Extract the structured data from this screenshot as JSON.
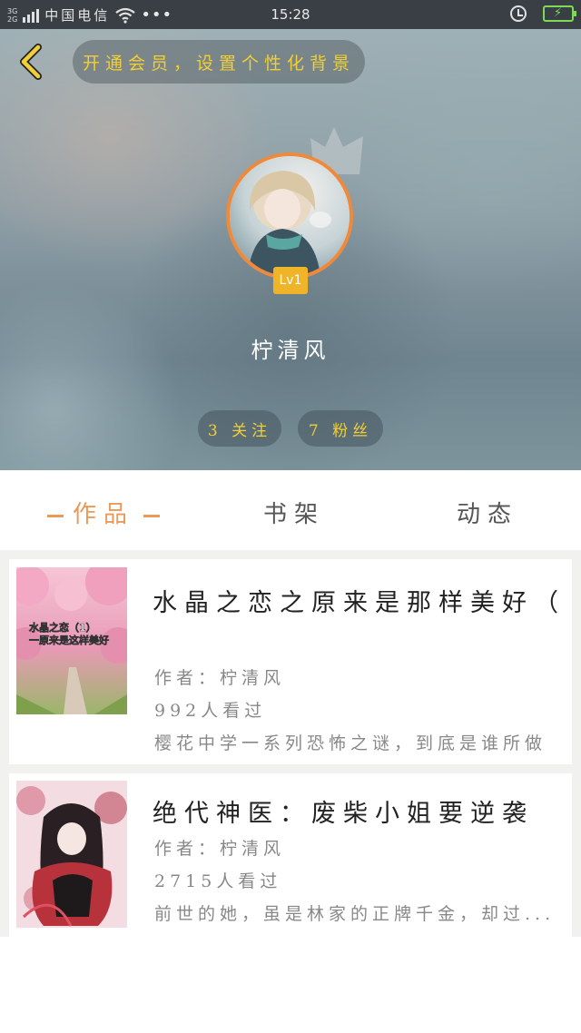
{
  "status_bar": {
    "network": "3G\n2G",
    "carrier": "中国电信",
    "more": "•••",
    "time": "15:28"
  },
  "header": {
    "vip_banner": "开通会员，设置个性化背景",
    "level": "Lv1",
    "username": "柠清风",
    "following": "3 关注",
    "fans": "7 粉丝"
  },
  "tabs": [
    {
      "label": "作品",
      "active": true
    },
    {
      "label": "书架",
      "active": false
    },
    {
      "label": "动态",
      "active": false
    }
  ],
  "books": [
    {
      "title": "水晶之恋之原来是那样美好（",
      "cover_text": "水晶之恋（1）\n一原来是这样美好",
      "author": "作者：柠清风",
      "views": "992人看过",
      "description": "樱花中学一系列恐怖之谜，到底是谁所做"
    },
    {
      "title": "绝代神医：废柴小姐要逆袭",
      "author": "作者：柠清风",
      "views": "2715人看过",
      "description": "前世的她，虽是林家的正牌千金，却过..."
    }
  ],
  "colors": {
    "accent": "#e99a57",
    "gold": "#f2cf35",
    "avatar_ring": "#f08a3a",
    "battery": "#7ed957"
  },
  "icons": [
    "signal-icon",
    "wifi-icon",
    "alarm-icon",
    "battery-icon",
    "back-arrow-icon",
    "cat-ear-decor-icon"
  ]
}
